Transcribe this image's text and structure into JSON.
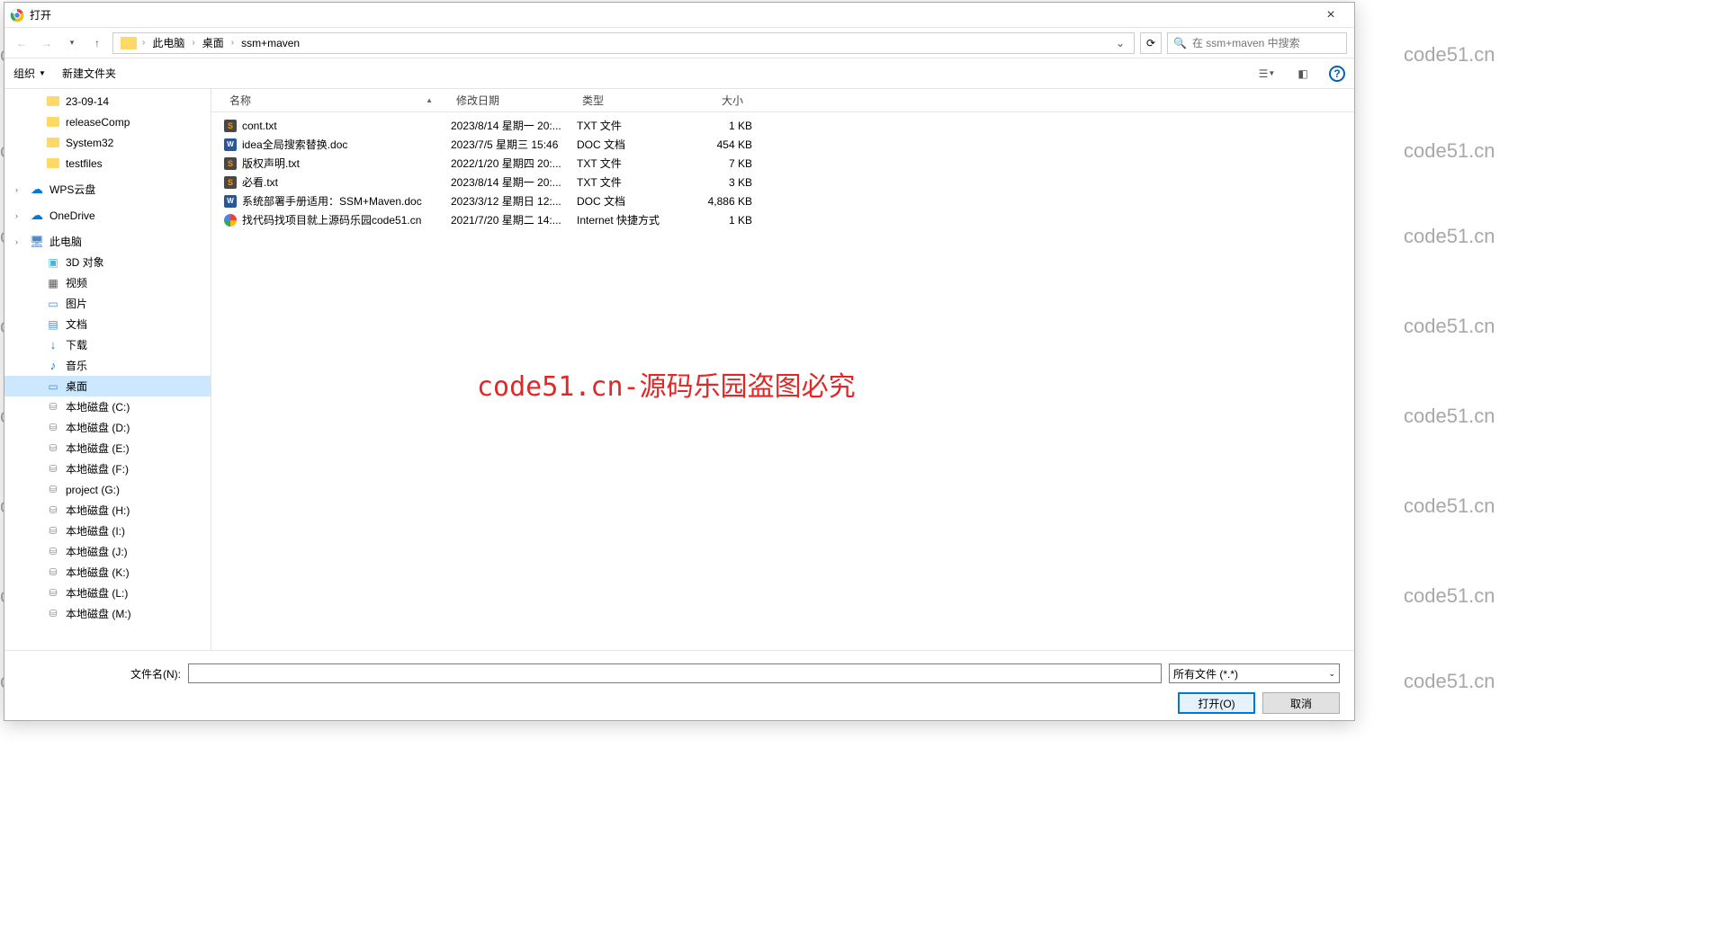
{
  "dialog": {
    "title": "打开",
    "close": "×"
  },
  "navbar": {
    "breadcrumb": [
      "此电脑",
      "桌面",
      "ssm+maven"
    ],
    "search_placeholder": "在 ssm+maven 中搜索"
  },
  "toolbar": {
    "organize": "组织",
    "newfolder": "新建文件夹"
  },
  "sidebar": {
    "folders": [
      {
        "label": "23-09-14",
        "icon": "folder"
      },
      {
        "label": "releaseComp",
        "icon": "folder"
      },
      {
        "label": "System32",
        "icon": "folder"
      },
      {
        "label": "testfiles",
        "icon": "folder"
      }
    ],
    "wps": "WPS云盘",
    "onedrive": "OneDrive",
    "thispc": "此电脑",
    "pcitems": [
      {
        "label": "3D 对象",
        "icon": "3d"
      },
      {
        "label": "视频",
        "icon": "video"
      },
      {
        "label": "图片",
        "icon": "img"
      },
      {
        "label": "文档",
        "icon": "doc"
      },
      {
        "label": "下载",
        "icon": "dl"
      },
      {
        "label": "音乐",
        "icon": "music"
      },
      {
        "label": "桌面",
        "icon": "desktop",
        "selected": true
      },
      {
        "label": "本地磁盘 (C:)",
        "icon": "disk"
      },
      {
        "label": "本地磁盘 (D:)",
        "icon": "disk"
      },
      {
        "label": "本地磁盘 (E:)",
        "icon": "disk"
      },
      {
        "label": "本地磁盘 (F:)",
        "icon": "disk"
      },
      {
        "label": "project (G:)",
        "icon": "disk"
      },
      {
        "label": "本地磁盘 (H:)",
        "icon": "disk"
      },
      {
        "label": "本地磁盘 (I:)",
        "icon": "disk"
      },
      {
        "label": "本地磁盘 (J:)",
        "icon": "disk"
      },
      {
        "label": "本地磁盘 (K:)",
        "icon": "disk"
      },
      {
        "label": "本地磁盘 (L:)",
        "icon": "disk"
      },
      {
        "label": "本地磁盘 (M:)",
        "icon": "disk"
      }
    ]
  },
  "columns": {
    "name": "名称",
    "date": "修改日期",
    "type": "类型",
    "size": "大小"
  },
  "files": [
    {
      "icon": "txt",
      "name": "cont.txt",
      "date": "2023/8/14 星期一 20:...",
      "type": "TXT 文件",
      "size": "1 KB"
    },
    {
      "icon": "doc",
      "name": "idea全局搜索替换.doc",
      "date": "2023/7/5 星期三 15:46",
      "type": "DOC 文档",
      "size": "454 KB"
    },
    {
      "icon": "txt",
      "name": "版权声明.txt",
      "date": "2022/1/20 星期四 20:...",
      "type": "TXT 文件",
      "size": "7 KB"
    },
    {
      "icon": "txt",
      "name": "必看.txt",
      "date": "2023/8/14 星期一 20:...",
      "type": "TXT 文件",
      "size": "3 KB"
    },
    {
      "icon": "doc",
      "name": "系统部署手册适用：SSM+Maven.doc",
      "date": "2023/3/12 星期日 12:...",
      "type": "DOC 文档",
      "size": "4,886 KB"
    },
    {
      "icon": "web",
      "name": "找代码找项目就上源码乐园code51.cn",
      "date": "2021/7/20 星期二 14:...",
      "type": "Internet 快捷方式",
      "size": "1 KB"
    }
  ],
  "bottom": {
    "filename_label": "文件名(N):",
    "filetype": "所有文件 (*.*)",
    "open": "打开(O)",
    "cancel": "取消"
  },
  "watermark_center": "code51.cn-源码乐园盗图必究",
  "watermark_bg": "code51.cn"
}
